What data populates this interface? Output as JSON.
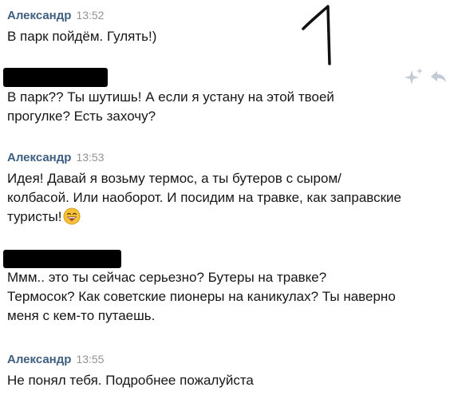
{
  "messages": [
    {
      "author": "Александр",
      "time": "13:52",
      "lines": [
        "В парк пойдём. Гулять!)"
      ]
    },
    {
      "author": "",
      "time": "",
      "lines": [
        "В парк?? Ты шутишь! А если я устану на этой твоей",
        "прогулке? Есть захочу?"
      ]
    },
    {
      "author": "Александр",
      "time": "13:53",
      "lines": [
        "Идея! Давай я возьму термос, а ты бутеров с сыром/",
        "колбасой. Или наоборот. И посидим на травке, как заправские",
        "туристы!"
      ]
    },
    {
      "author": "",
      "time": "",
      "lines": [
        "Ммм.. это ты сейчас серьезно? Бутеры на травке?",
        "Термосок? Как советские пионеры на каникулах? Ты наверно",
        "меня с кем-то путаешь."
      ]
    },
    {
      "author": "Александр",
      "time": "13:55",
      "lines": [
        "Не понял тебя. Подробнее пожалуйста"
      ]
    }
  ],
  "icons": {
    "emoji": "laughing-emoji-icon",
    "favorite": "sparkle-star-icon",
    "reply": "reply-arrow-icon",
    "annotation": "handwritten-number-one"
  },
  "colors": {
    "author": "#3e5f80",
    "time": "#939393",
    "text": "#161616",
    "redaction": "#000000",
    "icons": "#c3cbd4"
  }
}
